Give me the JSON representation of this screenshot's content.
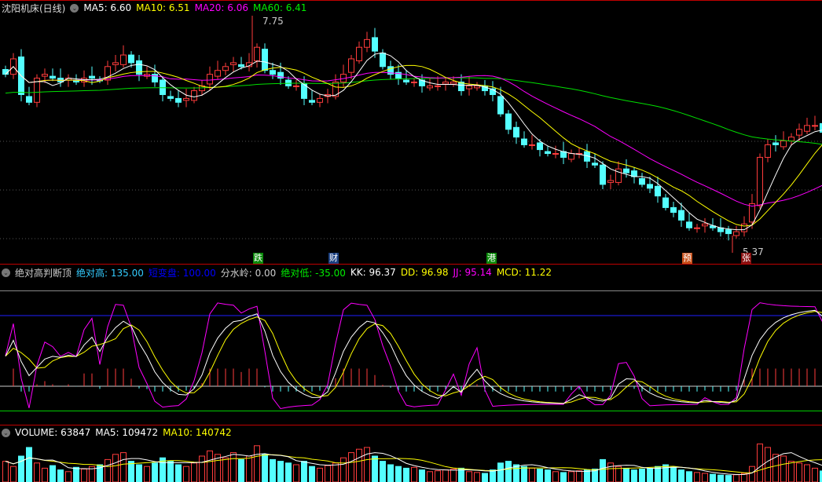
{
  "main_header": {
    "title": "沈阳机床(日线)",
    "ma5": "MA5: 6.60",
    "ma10": "MA10: 6.51",
    "ma20": "MA20: 6.06",
    "ma60": "MA60: 6.41"
  },
  "price_labels": {
    "high": "7.75",
    "low": "5.37"
  },
  "markers": [
    {
      "text": "跌",
      "color": "#0a8a0a"
    },
    {
      "text": "财",
      "color": "#1a3f80"
    },
    {
      "text": "港",
      "color": "#0a8a0a"
    },
    {
      "text": "预",
      "color": "#c8501a"
    },
    {
      "text": "张",
      "color": "#8a1010"
    }
  ],
  "indicator_header": {
    "name": "绝对高判断顶",
    "abs_high": "绝对高: 135.00",
    "short_var": "短变盘: 100.00",
    "watershed": "分水岭: 0.00",
    "abs_low": "绝对低: -35.00",
    "kk": "KK: 96.37",
    "dd": "DD: 96.98",
    "jj": "JJ: 95.14",
    "mcd": "MCD: 11.22"
  },
  "volume_header": {
    "volume": "VOLUME: 63847",
    "ma5": "MA5: 109472",
    "ma10": "MA10: 140742"
  },
  "colors": {
    "up": "#ff3c3c",
    "down": "#54ffff",
    "ma5": "#ffffff",
    "ma10": "#ffff00",
    "ma20": "#ff00ff",
    "ma60": "#00e000"
  },
  "chart_data": {
    "type": "candlestick",
    "price_range": [
      5.37,
      7.75
    ],
    "closes": [
      7.2,
      7.36,
      6.99,
      6.91,
      7.16,
      7.2,
      7.16,
      7.12,
      7.16,
      7.12,
      7.16,
      7.16,
      7.14,
      7.28,
      7.32,
      7.4,
      7.32,
      7.2,
      7.2,
      7.12,
      6.99,
      6.95,
      6.91,
      6.95,
      7.03,
      7.08,
      7.2,
      7.24,
      7.28,
      7.32,
      7.28,
      7.32,
      7.48,
      7.24,
      7.2,
      7.16,
      7.08,
      7.08,
      6.95,
      6.91,
      6.95,
      6.99,
      7.12,
      7.2,
      7.36,
      7.48,
      7.56,
      7.44,
      7.28,
      7.2,
      7.16,
      7.12,
      7.12,
      7.08,
      7.08,
      7.08,
      7.12,
      7.12,
      7.03,
      7.08,
      7.08,
      7.03,
      6.99,
      6.79,
      6.63,
      6.55,
      6.47,
      6.47,
      6.42,
      6.38,
      6.38,
      6.34,
      6.38,
      6.38,
      6.3,
      6.26,
      6.06,
      6.1,
      6.22,
      6.18,
      6.14,
      6.06,
      6.02,
      5.94,
      5.82,
      5.77,
      5.69,
      5.61,
      5.61,
      5.65,
      5.61,
      5.57,
      5.55,
      5.57,
      5.65,
      5.86,
      6.34,
      6.47,
      6.47,
      6.51,
      6.55,
      6.63,
      6.67,
      6.67,
      6.6
    ],
    "volumes": [
      120,
      90,
      150,
      200,
      110,
      80,
      95,
      70,
      60,
      85,
      75,
      90,
      100,
      130,
      160,
      170,
      120,
      100,
      90,
      110,
      140,
      120,
      100,
      90,
      110,
      150,
      180,
      160,
      140,
      170,
      130,
      150,
      210,
      160,
      130,
      120,
      110,
      100,
      120,
      90,
      80,
      95,
      110,
      140,
      170,
      190,
      200,
      150,
      120,
      100,
      90,
      80,
      85,
      70,
      60,
      65,
      70,
      75,
      80,
      60,
      55,
      50,
      70,
      110,
      120,
      100,
      90,
      80,
      75,
      70,
      60,
      55,
      60,
      65,
      70,
      75,
      130,
      110,
      90,
      80,
      70,
      75,
      80,
      90,
      100,
      85,
      70,
      60,
      55,
      50,
      45,
      40,
      38,
      42,
      50,
      90,
      220,
      200,
      160,
      150,
      120,
      110,
      100,
      80,
      64
    ]
  },
  "indicator_levels": {
    "abs_high": 135,
    "short_var": 100,
    "watershed": 0,
    "abs_low": -35
  }
}
